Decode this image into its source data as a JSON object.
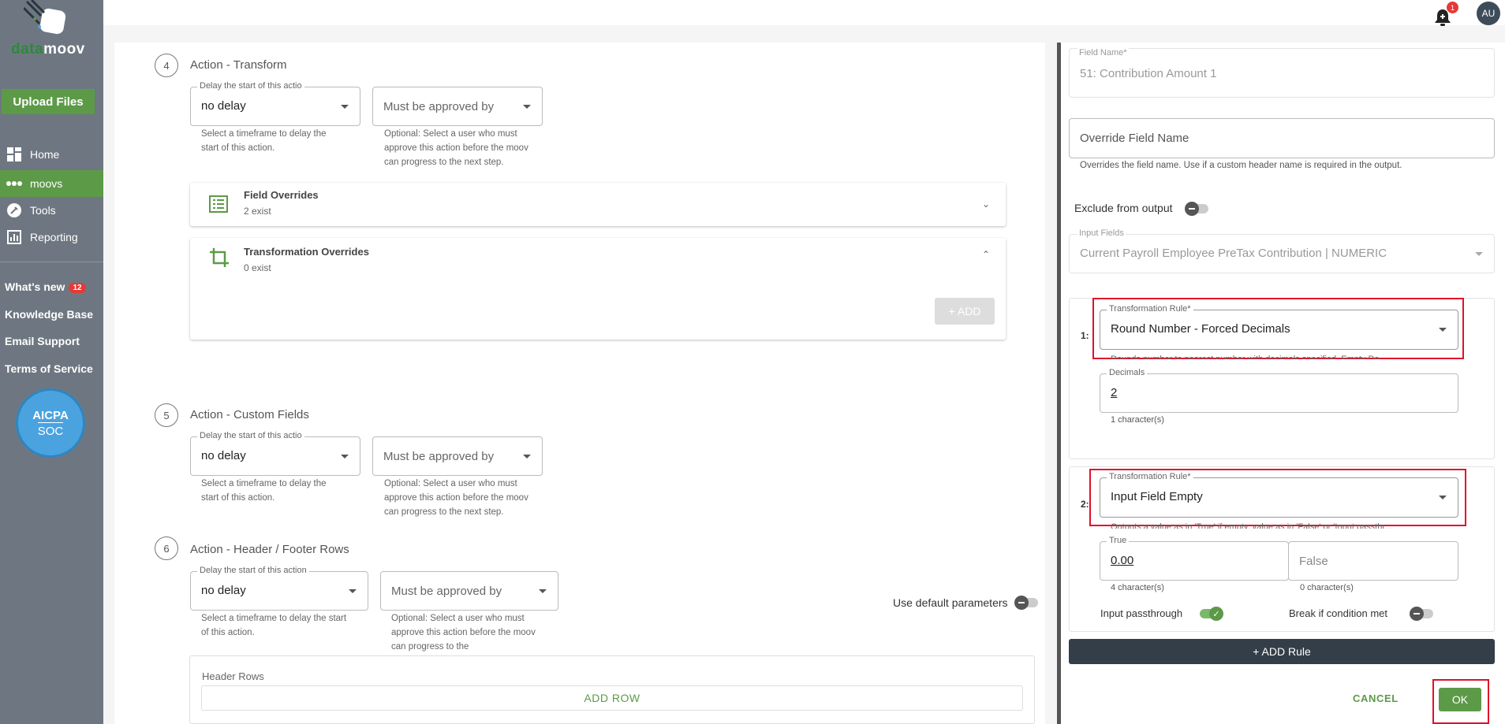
{
  "app": {
    "logo_text": "datamoov"
  },
  "sidebar": {
    "upload_label": "Upload Files",
    "nav": [
      {
        "label": "Home",
        "icon": "home-icon"
      },
      {
        "label": "moovs",
        "icon": "moovs-icon"
      },
      {
        "label": "Tools",
        "icon": "tools-icon"
      },
      {
        "label": "Reporting",
        "icon": "reporting-icon"
      }
    ],
    "whats_new_label": "What's new",
    "whats_new_count": "12",
    "knowledge_base": "Knowledge Base",
    "email_support": "Email Support",
    "terms": "Terms of Service",
    "badge_line1": "AICPA",
    "badge_line2": "SOC"
  },
  "topbar": {
    "notification_count": "1",
    "avatar_initials": "AU"
  },
  "steps": [
    {
      "number": "4",
      "title": "Action - Transform",
      "delay_label": "Delay the start of this actio",
      "delay_value": "no delay",
      "delay_help": "Select a timeframe to delay the start of this action.",
      "approve_placeholder": "Must be approved by",
      "approve_help": "Optional: Select a user who must approve this action before the moov can progress to the next step."
    },
    {
      "number": "5",
      "title": "Action - Custom Fields",
      "delay_label": "Delay the start of this actio",
      "delay_value": "no delay",
      "delay_help": "Select a timeframe to delay the start of this action.",
      "approve_placeholder": "Must be approved by",
      "approve_help": "Optional: Select a user who must approve this action before the moov can progress to the next step."
    },
    {
      "number": "6",
      "title": "Action - Header / Footer Rows",
      "delay_label": "Delay the start of this action",
      "delay_value": "no delay",
      "delay_help": "Select a timeframe to delay the start of this action.",
      "approve_placeholder": "Must be approved by",
      "approve_help": "Optional: Select a user who must approve this action before the moov can progress to the"
    }
  ],
  "field_overrides": {
    "title": "Field Overrides",
    "subtitle": "2 exist"
  },
  "transformation_overrides": {
    "title": "Transformation Overrides",
    "subtitle": "0 exist",
    "add_label": "+ ADD"
  },
  "header_footer": {
    "use_default_label": "Use default parameters",
    "header_rows_label": "Header Rows",
    "add_row_label": "ADD ROW"
  },
  "panel": {
    "field_name_label": "Field Name*",
    "field_name_value": "51: Contribution Amount 1",
    "override_placeholder": "Override Field Name",
    "override_help": "Overrides the field name. Use if a custom header name is required in the output.",
    "exclude_label": "Exclude from output",
    "input_fields_label": "Input Fields",
    "input_fields_value": "Current Payroll Employee PreTax Contribution | NUMERIC",
    "rules": [
      {
        "index": "1:",
        "rule_label": "Transformation Rule*",
        "rule_value": "Round Number - Forced Decimals",
        "rule_help": "Rounds number to nearest number with decimals specified. Empty De...",
        "param_label": "Decimals",
        "param_value": "2",
        "param_count": "1 character(s)"
      },
      {
        "index": "2:",
        "rule_label": "Transformation Rule*",
        "rule_value": "Input Field Empty",
        "rule_help": "Outputs a value as in 'True' if empty, value as in 'False' or 'Input passthr...",
        "true_label": "True",
        "true_value": "0.00",
        "true_count": "4 character(s)",
        "false_placeholder": "False",
        "false_count": "0 character(s)",
        "passthrough_label": "Input passthrough",
        "break_label": "Break if condition met"
      }
    ],
    "add_rule_label": "+ ADD Rule",
    "cancel_label": "CANCEL",
    "ok_label": "OK"
  },
  "colors": {
    "sidebar": "#6e7781",
    "accent_green": "#5c9a48",
    "highlight_red": "#e0102a",
    "dark_button": "#333e48"
  }
}
